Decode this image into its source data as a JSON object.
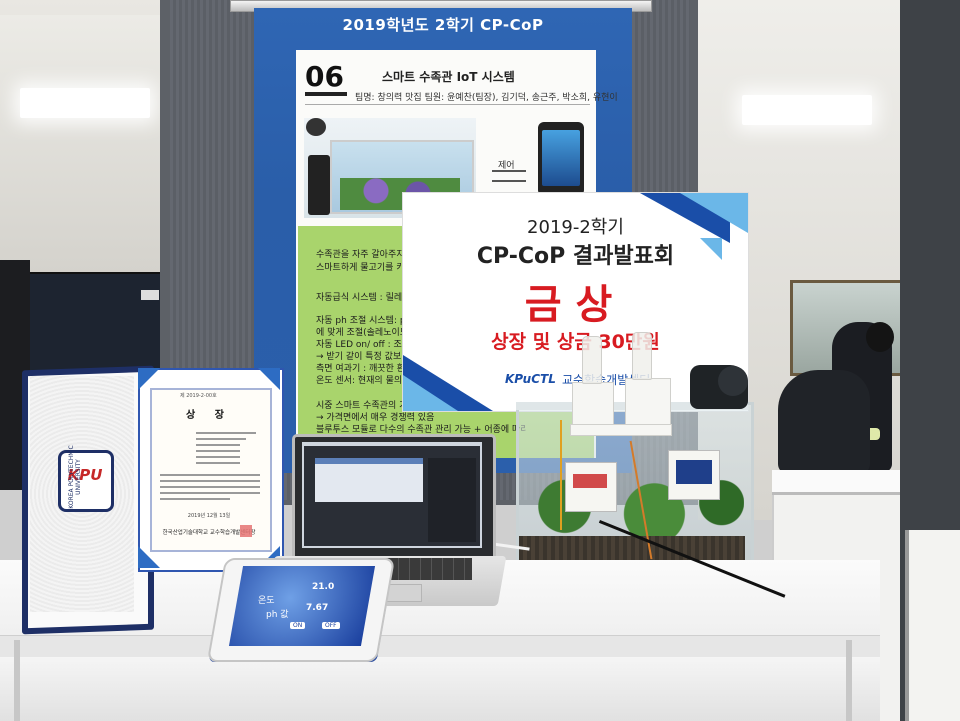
{
  "poster": {
    "header": "2019학년도 2학기 CP-CoP",
    "number": "06",
    "project": "스마트 수족관 IoT 시스템",
    "team": "팀명: 창의력 맛집  팀원: 윤예찬(팀장), 김기덕, 송근주, 박소희, 유현이",
    "control_label": "제어",
    "bullets": [
      "수족관을 자주 갈아주지 못하는",
      "스마트하게 물고기를 키울 수 있",
      "자동급식 시스템 : 릴레이모듈+",
      "자동 ph 조절 시스템: ph센서가",
      "에 맞게 조절(솔레노이드밸브를",
      "자동 LED on/ off : 조도센서",
      "→ 받기 같이 특정 값보다 작아",
      "측면 여과기 : 깨끗한 환경 조성",
      "온도 센서: 현재의 물의 온도를",
      "시중 스마트 수족관의 가격: 약 150~",
      "→ 가격면에서 매우 경쟁력 있음",
      "블루투스 모듈로 다수의 수족관 관리 가능 + 어종에 따라 자동 ph조절 관리 시스템"
    ]
  },
  "sign": {
    "line1": "2019-2학기",
    "line2": "CP-CoP 결과발표회",
    "award": "금상",
    "prize": "상장 및 상금 30만원",
    "logo": "KPuCTL",
    "org": "교수학습개발센터"
  },
  "certificate": {
    "number": "제 2019-2-00호",
    "title": "상 장",
    "date": "2019년 12월 13일",
    "issuer": "한국산업기술대학교 교수학습개발센터장",
    "seal_color": "#e57373"
  },
  "folder": {
    "logo": "KPU",
    "logo_arc": "KOREA POLYTECHNIC UNIVERSITY",
    "frame_color": "#1e2f66"
  },
  "tablet": {
    "values": [
      "21.0",
      "7.67"
    ],
    "labels": [
      "온도",
      "ph 값"
    ],
    "buttons": [
      "ON",
      "OFF"
    ]
  },
  "colors": {
    "poster_blue": "#2a5ea9",
    "sign_red": "#d81b21",
    "sign_blue": "#1a4ea8"
  }
}
